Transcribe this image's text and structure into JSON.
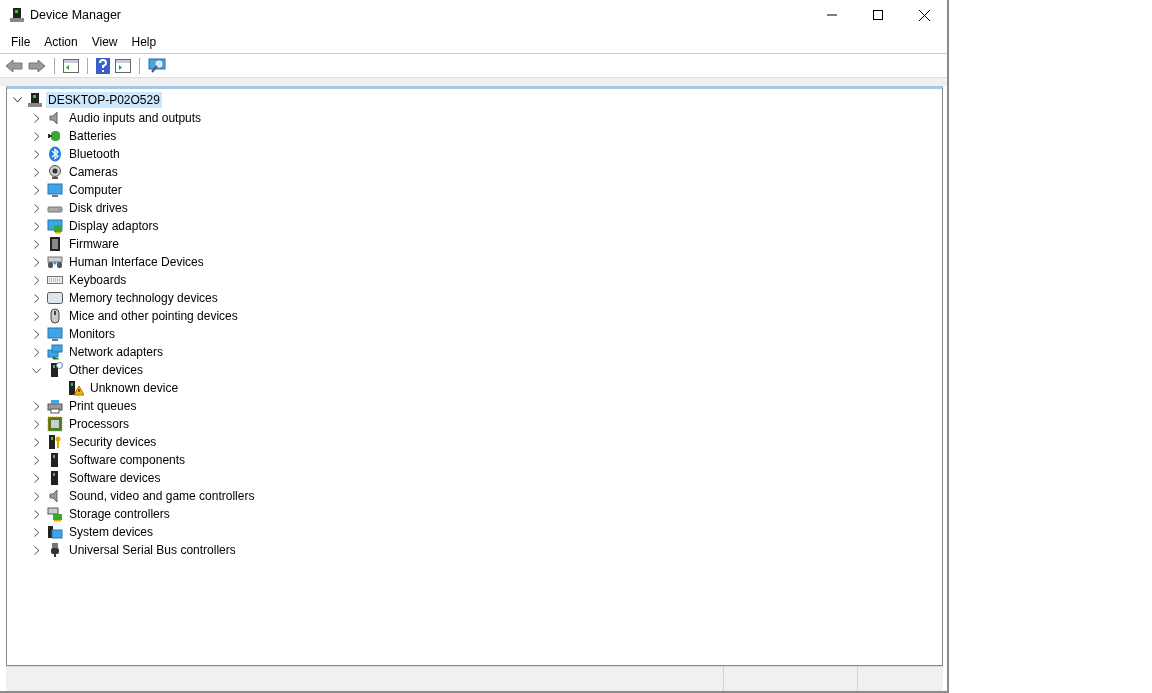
{
  "window": {
    "title": "Device Manager"
  },
  "menu": [
    {
      "label": "File"
    },
    {
      "label": "Action"
    },
    {
      "label": "View"
    },
    {
      "label": "Help"
    }
  ],
  "tree": {
    "label": "DESKTOP-P02O529",
    "selected": true,
    "expanded": true,
    "children": [
      {
        "label": "Audio inputs and outputs",
        "expanded": false
      },
      {
        "label": "Batteries",
        "expanded": false
      },
      {
        "label": "Bluetooth",
        "expanded": false
      },
      {
        "label": "Cameras",
        "expanded": false
      },
      {
        "label": "Computer",
        "expanded": false
      },
      {
        "label": "Disk drives",
        "expanded": false
      },
      {
        "label": "Display adaptors",
        "expanded": false
      },
      {
        "label": "Firmware",
        "expanded": false
      },
      {
        "label": "Human Interface Devices",
        "expanded": false
      },
      {
        "label": "Keyboards",
        "expanded": false
      },
      {
        "label": "Memory technology devices",
        "expanded": false
      },
      {
        "label": "Mice and other pointing devices",
        "expanded": false
      },
      {
        "label": "Monitors",
        "expanded": false
      },
      {
        "label": "Network adapters",
        "expanded": false
      },
      {
        "label": "Other devices",
        "expanded": true,
        "children": [
          {
            "label": "Unknown device"
          }
        ]
      },
      {
        "label": "Print queues",
        "expanded": false
      },
      {
        "label": "Processors",
        "expanded": false
      },
      {
        "label": "Security devices",
        "expanded": false
      },
      {
        "label": "Software components",
        "expanded": false
      },
      {
        "label": "Software devices",
        "expanded": false
      },
      {
        "label": "Sound, video and game controllers",
        "expanded": false
      },
      {
        "label": "Storage controllers",
        "expanded": false
      },
      {
        "label": "System devices",
        "expanded": false
      },
      {
        "label": "Universal Serial Bus controllers",
        "expanded": false
      }
    ]
  }
}
